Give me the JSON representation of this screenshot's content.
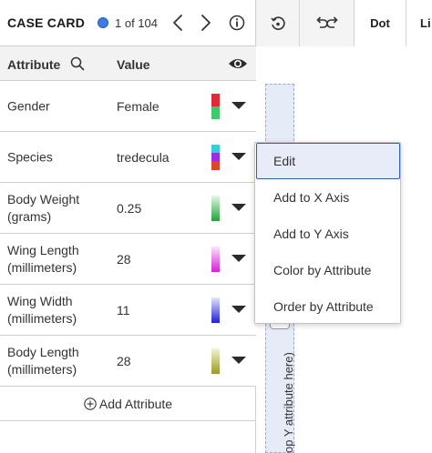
{
  "header": {
    "title": "CASE CARD",
    "count": "1 of 104"
  },
  "toolbar": {
    "plot_type_label": "Dot",
    "next_label": "Li"
  },
  "table": {
    "attribute_header": "Attribute",
    "value_header": "Value",
    "rows": [
      {
        "name": "Gender",
        "value": "Female",
        "colors": [
          "#e02a3a",
          "#3ec96a"
        ]
      },
      {
        "name": "Species",
        "value": "tredecula",
        "colors": [
          "#2fd1d6",
          "#9b2fe0",
          "#e0452a"
        ]
      },
      {
        "name": "Body Weight (grams)",
        "value": "0.25",
        "colors": [
          "#e8f7e8",
          "#1fa33a"
        ]
      },
      {
        "name": "Wing Length (millimeters)",
        "value": "28",
        "colors": [
          "#fbe6fb",
          "#d61fd6"
        ]
      },
      {
        "name": "Wing Width (millimeters)",
        "value": "11",
        "colors": [
          "#e6e6fb",
          "#1f1fd6"
        ]
      },
      {
        "name": "Body Length (millimeters)",
        "value": "28",
        "colors": [
          "#f3f3d8",
          "#9a9a1f"
        ]
      }
    ],
    "add_attribute_label": "Add Attribute"
  },
  "graph": {
    "drop_label": "op Y attribute here)"
  },
  "menu": {
    "items": [
      "Edit",
      "Add to X Axis",
      "Add to Y Axis",
      "Color by Attribute",
      "Order by Attribute"
    ]
  }
}
